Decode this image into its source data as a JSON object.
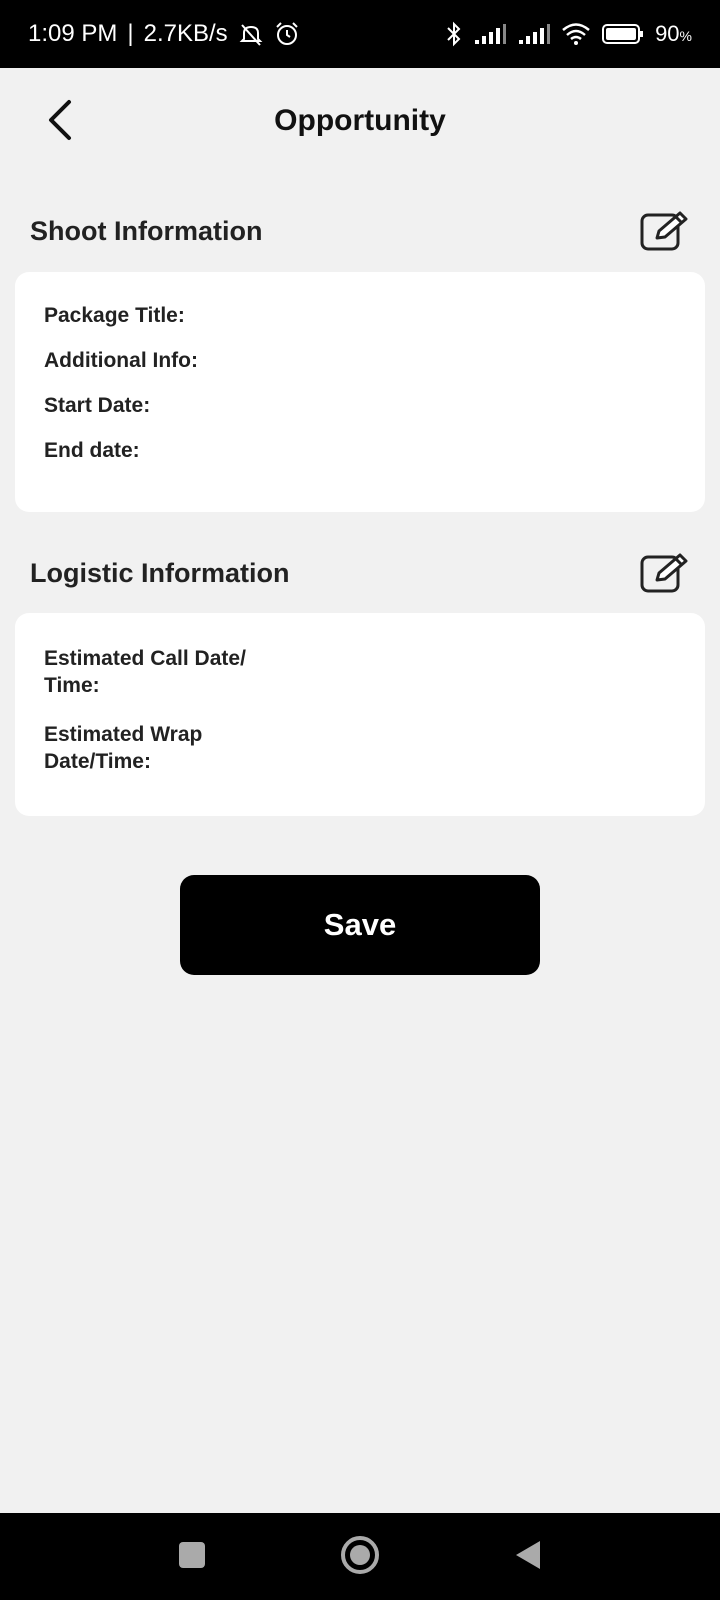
{
  "status_bar": {
    "time": "1:09 PM",
    "separator": "|",
    "network_speed": "2.7KB/s",
    "battery_percent": "90",
    "battery_unit": "%",
    "icons": [
      "muted-bell-icon",
      "alarm-icon",
      "bluetooth-icon",
      "signal-icon",
      "signal-icon",
      "wifi-icon",
      "battery-icon"
    ]
  },
  "header": {
    "title": "Opportunity",
    "back_icon": "chevron-left-icon"
  },
  "shoot_section": {
    "title": "Shoot Information",
    "edit_icon": "edit-icon",
    "fields": [
      {
        "label": "Package Title:"
      },
      {
        "label": "Additional Info:"
      },
      {
        "label": "Start Date:"
      },
      {
        "label": "End date:"
      }
    ]
  },
  "logistic_section": {
    "title": "Logistic Information",
    "edit_icon": "edit-icon",
    "fields": [
      {
        "label": "Estimated Call Date/\nTime:"
      },
      {
        "label": "Estimated Wrap\nDate/Time:"
      }
    ]
  },
  "actions": {
    "save_label": "Save"
  },
  "nav_bar": {
    "icons": [
      "recents-square-icon",
      "home-circle-icon",
      "back-triangle-icon"
    ]
  }
}
